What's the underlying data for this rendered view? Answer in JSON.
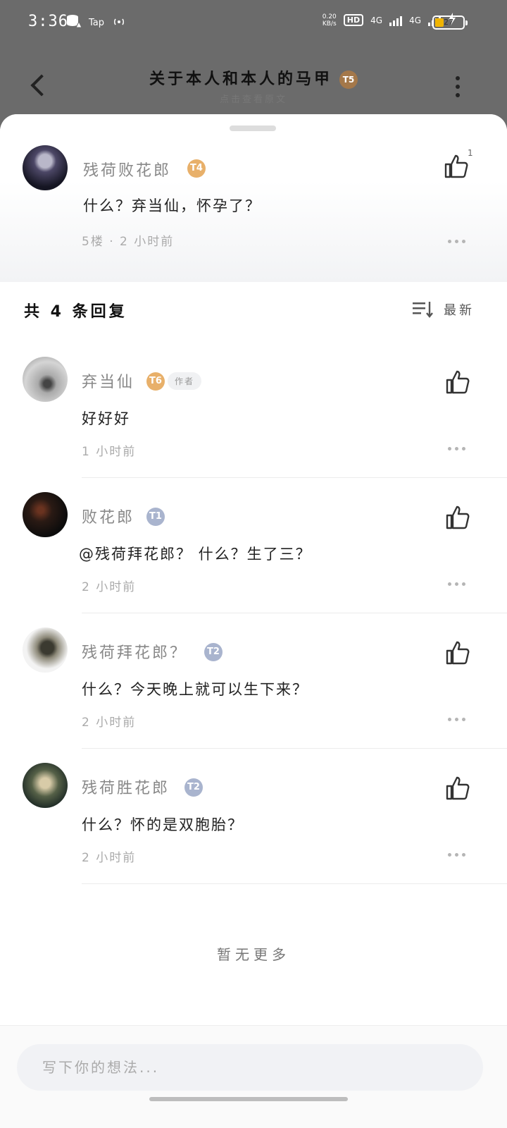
{
  "status_bar": {
    "time": "3:36",
    "tap_label": "Tap",
    "net_speed_value": "0.20",
    "net_speed_unit": "KB/s",
    "hd_label": "HD",
    "hd_sub": "1 2",
    "network1": "4G",
    "network2": "4G",
    "battery_level": "27"
  },
  "header": {
    "title": "关于本人和本人的马甲",
    "title_level": "T5",
    "subtitle": "点击查看原文"
  },
  "main_comment": {
    "author": "残荷败花郎",
    "level": "T4",
    "text": "什么？弃当仙，怀孕了？",
    "meta": "5楼 · 2 小时前",
    "like_count": "1"
  },
  "replies_header": {
    "count_label": "共 4 条回复",
    "sort_label": "最新"
  },
  "replies": [
    {
      "author": "弃当仙",
      "level": "T6",
      "tag": "作者",
      "text": "好好好",
      "time": "1 小时前"
    },
    {
      "author": "败花郎",
      "level": "T1",
      "tag": "",
      "text": "@残荷拜花郎？  什么？生了三？",
      "time": "2 小时前"
    },
    {
      "author": "残荷拜花郎？",
      "level": "T2",
      "tag": "",
      "text": "什么？今天晚上就可以生下来？",
      "time": "2 小时前"
    },
    {
      "author": "残荷胜花郎",
      "level": "T2",
      "tag": "",
      "text": "什么？怀的是双胞胎？",
      "time": "2 小时前"
    }
  ],
  "no_more_label": "暂无更多",
  "input": {
    "placeholder": "写下你的想法..."
  },
  "colors": {
    "level_gold": "#e8b06a",
    "level_silver": "#a9b4ce",
    "overlay": "#6b6b6b"
  }
}
